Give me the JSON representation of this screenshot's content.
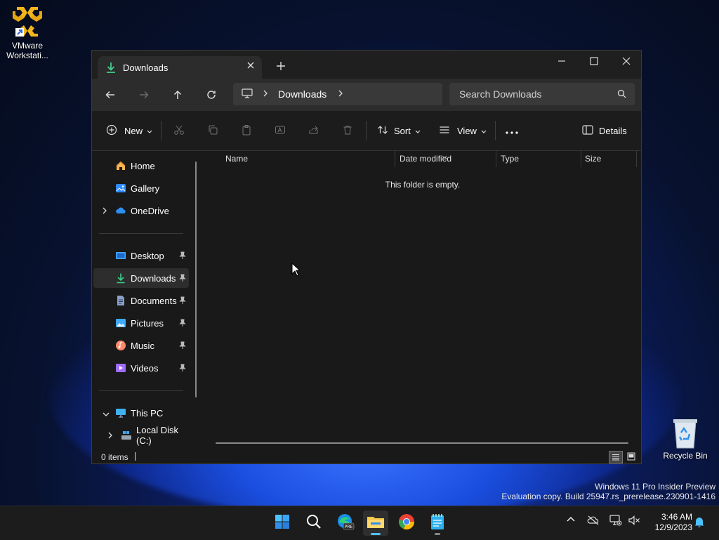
{
  "desktop": {
    "icons": [
      {
        "label": "VMware Workstati..."
      },
      {
        "label": "Recycle Bin"
      }
    ],
    "watermark": {
      "line1": "Windows 11 Pro Insider Preview",
      "line2": "Evaluation copy. Build 25947.rs_prerelease.230901-1416"
    }
  },
  "explorer": {
    "tab_title": "Downloads",
    "address": {
      "root_icon": "pc-icon",
      "path": [
        "Downloads"
      ]
    },
    "search_placeholder": "Search Downloads",
    "toolbar": {
      "new_label": "New",
      "sort_label": "Sort",
      "view_label": "View",
      "more_label": "...",
      "details_label": "Details"
    },
    "sidebar": {
      "top": [
        {
          "label": "Home",
          "icon": "home-icon"
        },
        {
          "label": "Gallery",
          "icon": "gallery-icon"
        },
        {
          "label": "OneDrive",
          "icon": "onedrive-icon",
          "expandable": true
        }
      ],
      "pinned": [
        {
          "label": "Desktop",
          "icon": "desktop-icon",
          "color": "#4aa8ff"
        },
        {
          "label": "Downloads",
          "icon": "downloads-icon",
          "color": "#3fd08a",
          "selected": true
        },
        {
          "label": "Documents",
          "icon": "documents-icon",
          "color": "#8aa0c8"
        },
        {
          "label": "Pictures",
          "icon": "pictures-icon",
          "color": "#3fa9ff"
        },
        {
          "label": "Music",
          "icon": "music-icon",
          "color": "#ff8a6a"
        },
        {
          "label": "Videos",
          "icon": "videos-icon",
          "color": "#a06bff"
        }
      ],
      "this_pc": {
        "label": "This PC",
        "expanded": true
      },
      "local_disk": {
        "label": "Local Disk (C:)"
      }
    },
    "columns": [
      "Name",
      "Date modified",
      "Type",
      "Size"
    ],
    "empty_message": "This folder is empty.",
    "status": {
      "items": "0 items"
    }
  },
  "taskbar": {
    "apps": [
      {
        "name": "start-icon"
      },
      {
        "name": "search-icon"
      },
      {
        "name": "edge-pre-icon",
        "badge": "PRE"
      },
      {
        "name": "file-explorer-icon",
        "active": true
      },
      {
        "name": "chrome-icon"
      },
      {
        "name": "notepad-icon"
      }
    ],
    "clock": {
      "time": "3:46 AM",
      "date": "12/9/2023"
    }
  },
  "colors": {
    "accent": "#4cc2ff",
    "downloads_green": "#3fd08a",
    "folder_yellow": "#f7c948"
  }
}
